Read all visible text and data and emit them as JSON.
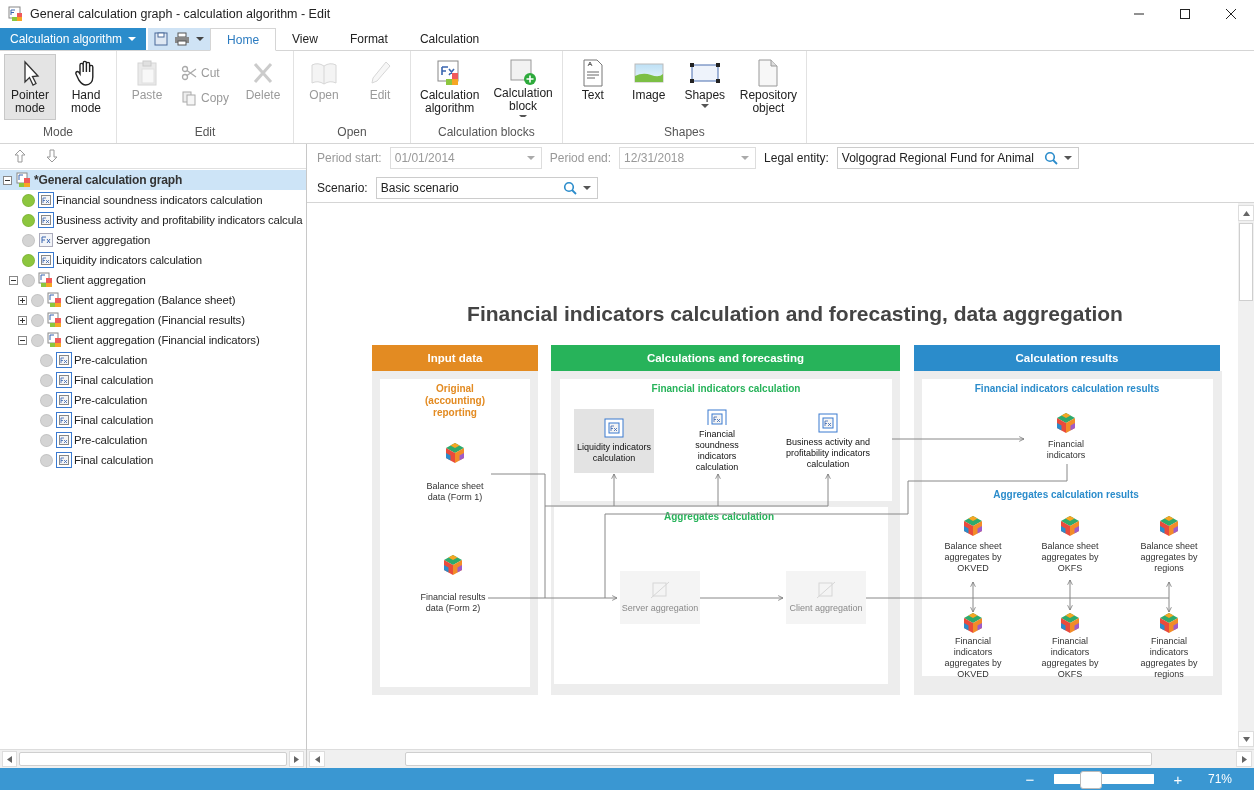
{
  "window": {
    "title": "General calculation graph - calculation algorithm - Edit"
  },
  "app_menu": {
    "label": "Calculation algorithm"
  },
  "tabs": [
    {
      "label": "Home",
      "selected": true
    },
    {
      "label": "View",
      "selected": false
    },
    {
      "label": "Format",
      "selected": false
    },
    {
      "label": "Calculation",
      "selected": false
    }
  ],
  "ribbon": [
    {
      "label": "Mode",
      "buttons": [
        {
          "kind": "large",
          "label": "Pointer mode",
          "selected": true,
          "disabled": false
        },
        {
          "kind": "large",
          "label": "Hand mode",
          "selected": false,
          "disabled": false
        }
      ]
    },
    {
      "label": "Edit",
      "buttons": [
        {
          "kind": "large",
          "label": "Paste",
          "disabled": true
        },
        {
          "kind": "small",
          "label": "Cut",
          "disabled": true
        },
        {
          "kind": "small",
          "label": "Copy",
          "disabled": true
        },
        {
          "kind": "large",
          "label": "Delete",
          "disabled": true
        }
      ]
    },
    {
      "label": "Open",
      "buttons": [
        {
          "kind": "large",
          "label": "Open",
          "disabled": true
        },
        {
          "kind": "large",
          "label": "Edit",
          "disabled": true
        }
      ]
    },
    {
      "label": "Calculation blocks",
      "buttons": [
        {
          "kind": "large",
          "label": "Calculation algorithm",
          "disabled": false
        },
        {
          "kind": "large",
          "label": "Calculation block",
          "disabled": false,
          "dropdown": true
        }
      ]
    },
    {
      "label": "Shapes",
      "buttons": [
        {
          "kind": "large",
          "label": "Text",
          "disabled": false
        },
        {
          "kind": "large",
          "label": "Image",
          "disabled": false
        },
        {
          "kind": "large",
          "label": "Shapes",
          "disabled": false,
          "dropdown": true
        },
        {
          "kind": "large",
          "label": "Repository object",
          "disabled": false
        }
      ]
    }
  ],
  "tree": [
    {
      "label": "*General calculation graph",
      "kind": "client",
      "selected": true,
      "expanded": true,
      "children": [
        {
          "label": "Financial soundness indicators calculation",
          "kind": "algorithm",
          "selected": false,
          "color": "#8cc63e"
        },
        {
          "label": "Business activity and profitability indicators calcula",
          "kind": "algorithm",
          "selected": false,
          "color": "#8cc63e"
        },
        {
          "label": "Server aggregation",
          "kind": "server",
          "selected": false,
          "color": "#d4d4d4"
        },
        {
          "label": "Liquidity indicators calculation",
          "kind": "algorithm",
          "selected": false,
          "color": "#8cc63e"
        },
        {
          "label": "Client aggregation",
          "kind": "client",
          "selected": false,
          "color": "#d4d4d4",
          "expanded": true,
          "children": [
            {
              "label": "Client aggregation (Balance sheet)",
              "kind": "client",
              "selected": false,
              "color": "#d4d4d4",
              "expanded": false
            },
            {
              "label": "Client aggregation (Financial results)",
              "kind": "client",
              "selected": false,
              "color": "#d4d4d4",
              "expanded": false
            },
            {
              "label": "Client aggregation (Financial indicators)",
              "kind": "client",
              "selected": false,
              "color": "#d4d4d4",
              "expanded": true,
              "children": [
                {
                  "label": "Pre-calculation",
                  "kind": "algorithm",
                  "selected": false,
                  "color": "#d4d4d4"
                },
                {
                  "label": "Final calculation",
                  "kind": "algorithm",
                  "selected": false,
                  "color": "#d4d4d4"
                },
                {
                  "label": "Pre-calculation",
                  "kind": "algorithm",
                  "selected": false,
                  "color": "#d4d4d4"
                },
                {
                  "label": "Final calculation",
                  "kind": "algorithm",
                  "selected": false,
                  "color": "#d4d4d4"
                },
                {
                  "label": "Pre-calculation",
                  "kind": "algorithm",
                  "selected": false,
                  "color": "#d4d4d4"
                },
                {
                  "label": "Final calculation",
                  "kind": "algorithm",
                  "selected": false,
                  "color": "#d4d4d4"
                }
              ]
            }
          ]
        }
      ]
    }
  ],
  "filters": [
    {
      "label": "Period start:",
      "value": "01/01/2014",
      "disabled": true,
      "kind": "date"
    },
    {
      "label": "Period end:",
      "value": "12/31/2018",
      "disabled": true,
      "kind": "date"
    },
    {
      "label": "Legal entity:",
      "value": "Volgograd Regional Fund for Animal",
      "disabled": false,
      "kind": "lookup"
    },
    {
      "label": "Scenario:",
      "value": "Basic scenario",
      "disabled": false,
      "kind": "lookup"
    }
  ],
  "diagram": {
    "title": "Financial indicators calculation and forecasting, data aggregation",
    "input": {
      "header": "Input data",
      "color": "#e38b22",
      "subtitle": "Original (accounting) reporting",
      "sources": [
        "Balance sheet data (Form 1)",
        "Financial results data (Form 2)"
      ]
    },
    "calculations": {
      "header": "Calculations and forecasting",
      "color": "#27b35a",
      "indicators_title": "Financial indicators calculation",
      "blocks": [
        {
          "label": "Liquidity indicators calculation",
          "selected": true
        },
        {
          "label": "Financial soundness indicators calculation",
          "selected": false
        },
        {
          "label": "Business activity and profitability indicators calculation",
          "selected": false
        }
      ],
      "aggregates_title": "Aggregates calculation",
      "aggregations": [
        {
          "label": "Server aggregation",
          "disabled": true
        },
        {
          "label": "Client aggregation",
          "disabled": true
        }
      ]
    },
    "results": {
      "header": "Calculation results",
      "color": "#2b8ccb",
      "indicators_title": "Financial indicators calculation results",
      "indicators": [
        "Financial indicators"
      ],
      "aggregates_title": "Aggregates calculation results",
      "aggregates": [
        "Balance sheet aggregates by OKVED",
        "Balance sheet aggregates by OKFS",
        "Balance sheet aggregates by regions",
        "Financial indicators aggregates by OKVED",
        "Financial indicators aggregates by OKFS",
        "Financial indicators aggregates by regions"
      ]
    }
  },
  "status_bar": {
    "zoom_out": "−",
    "zoom_in": "+",
    "zoom": {
      "level": 0.33,
      "reading": "71%"
    }
  }
}
